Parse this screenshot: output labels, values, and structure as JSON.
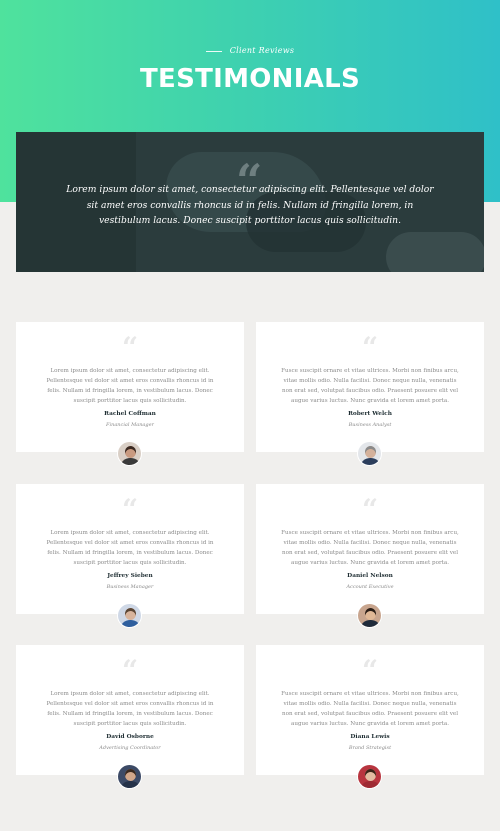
{
  "hero": {
    "eyebrow": "Client Reviews",
    "title": "TESTIMONIALS"
  },
  "feature": {
    "quote": "Lorem ipsum dolor sit amet, consectetur adipiscing elit. Pellentesque vel dolor sit amet eros convallis rhoncus id in felis. Nullam id fringilla lorem, in vestibulum lacus. Donec suscipit porttitor lacus quis sollicitudin."
  },
  "testimonials": [
    {
      "text": "Lorem ipsum dolor sit amet, consectetur adipiscing elit. Pellentesque vel dolor sit amet eros convallis rhoncus id in felis. Nullam id fringilla lorem, in vestibulum lacus. Donec suscipit porttitor lacus quis sollicitudin.",
      "name": "Rachel Coffman",
      "role": "Financial Manager",
      "avatar": {
        "bg": "#d9cfc6",
        "skin": "#c99a80",
        "hair": "#3b2a22",
        "shirt": "#3a3a3a"
      }
    },
    {
      "text": "Fusce suscipit ornare et vitae ultrices. Morbi non finibus arcu, vitae mollis odio. Nulla facilisi. Donec neque nulla, venenatis non erat sed, volutpat faucibus odio. Praesent posuere elit vel augue varius luctus. Nunc gravida et lorem amet porta.",
      "name": "Robert Welch",
      "role": "Business Analyst",
      "avatar": {
        "bg": "#e3e6ea",
        "skin": "#d4b19b",
        "hair": "#8a8a8a",
        "shirt": "#2c3e5c"
      }
    },
    {
      "text": "Lorem ipsum dolor sit amet, consectetur adipiscing elit. Pellentesque vel dolor sit amet eros convallis rhoncus id in felis. Nullam id fringilla lorem, in vestibulum lacus. Donec suscipit porttitor lacus quis sollicitudin.",
      "name": "Jeffrey Sieben",
      "role": "Business Manager",
      "avatar": {
        "bg": "#cfd8e6",
        "skin": "#d8b49c",
        "hair": "#5a4534",
        "shirt": "#2f5f9e"
      }
    },
    {
      "text": "Fusce suscipit ornare et vitae ultrices. Morbi non finibus arcu, vitae mollis odio. Nulla facilisi. Donec neque nulla, venenatis non erat sed, volutpat faucibus odio. Praesent posuere elit vel augue varius luctus. Nunc gravida et lorem amet porta.",
      "name": "Daniel Nelson",
      "role": "Account Executive",
      "avatar": {
        "bg": "#c8a58e",
        "skin": "#e0b896",
        "hair": "#2a1d16",
        "shirt": "#1f2a3a"
      }
    },
    {
      "text": "Lorem ipsum dolor sit amet, consectetur adipiscing elit. Pellentesque vel dolor sit amet eros convallis rhoncus id in felis. Nullam id fringilla lorem, in vestibulum lacus. Donec suscipit porttitor lacus quis sollicitudin.",
      "name": "David Osborne",
      "role": "Advertising Coordinator",
      "avatar": {
        "bg": "#3c4a66",
        "skin": "#d2a78a",
        "hair": "#3a2a20",
        "shirt": "#253249"
      }
    },
    {
      "text": "Fusce suscipit ornare et vitae ultrices. Morbi non finibus arcu, vitae mollis odio. Nulla facilisi. Donec neque nulla, venenatis non erat sed, volutpat faucibus odio. Praesent posuere elit vel augue varius luctus. Nunc gravida et lorem amet porta.",
      "name": "Diana Lewis",
      "role": "Brand Strategist",
      "avatar": {
        "bg": "#b8353f",
        "skin": "#e3bda2",
        "hair": "#3b2418",
        "shirt": "#9e2a33"
      }
    }
  ]
}
